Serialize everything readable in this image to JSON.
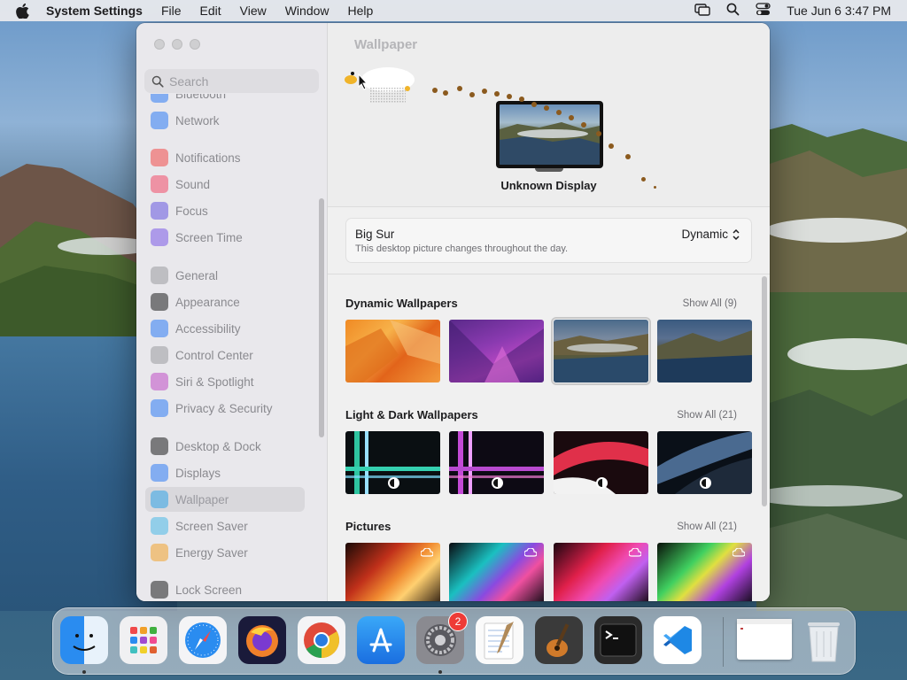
{
  "menubar": {
    "app_name": "System Settings",
    "menus": [
      "File",
      "Edit",
      "View",
      "Window",
      "Help"
    ],
    "clock": "Tue Jun 6  3:47 PM"
  },
  "sidebar": {
    "search_placeholder": "Search",
    "items": [
      {
        "label": "Bluetooth",
        "icon": "bluetooth-icon",
        "color": "#2f7cf6"
      },
      {
        "label": "Network",
        "icon": "globe-icon",
        "color": "#2f7cf6"
      },
      {
        "label": "Notifications",
        "icon": "bell-icon",
        "color": "#f24a4a"
      },
      {
        "label": "Sound",
        "icon": "speaker-icon",
        "color": "#f24a6a"
      },
      {
        "label": "Focus",
        "icon": "moon-icon",
        "color": "#6655e0"
      },
      {
        "label": "Screen Time",
        "icon": "hourglass-icon",
        "color": "#7b5ae8"
      },
      {
        "label": "General",
        "icon": "gear-icon",
        "color": "#9a9aa0"
      },
      {
        "label": "Appearance",
        "icon": "appearance-icon",
        "color": "#1d1d1f"
      },
      {
        "label": "Accessibility",
        "icon": "accessibility-icon",
        "color": "#2f7cf6"
      },
      {
        "label": "Control Center",
        "icon": "control-center-icon",
        "color": "#9a9aa0"
      },
      {
        "label": "Siri & Spotlight",
        "icon": "siri-icon",
        "color": "#c04cc6"
      },
      {
        "label": "Privacy & Security",
        "icon": "hand-icon",
        "color": "#2f7cf6"
      },
      {
        "label": "Desktop & Dock",
        "icon": "dock-icon",
        "color": "#1d1d1f"
      },
      {
        "label": "Displays",
        "icon": "sun-icon",
        "color": "#2f7cf6"
      },
      {
        "label": "Wallpaper",
        "icon": "wallpaper-icon",
        "color": "#2fa4e8"
      },
      {
        "label": "Screen Saver",
        "icon": "screensaver-icon",
        "color": "#4ab8e8"
      },
      {
        "label": "Energy Saver",
        "icon": "battery-icon",
        "color": "#f2a22e"
      },
      {
        "label": "Lock Screen",
        "icon": "lock-icon",
        "color": "#1d1d1f"
      }
    ],
    "selected": "Wallpaper"
  },
  "content": {
    "title": "Wallpaper",
    "display_name": "Unknown Display",
    "wallpaper": {
      "name": "Big Sur",
      "description": "This desktop picture changes throughout the day.",
      "mode": "Dynamic"
    },
    "sections": [
      {
        "title": "Dynamic Wallpapers",
        "show_all": "Show All (9)"
      },
      {
        "title": "Light & Dark Wallpapers",
        "show_all": "Show All (21)"
      },
      {
        "title": "Pictures",
        "show_all": "Show All (21)"
      }
    ]
  },
  "dock": {
    "apps": [
      {
        "name": "Finder",
        "icon": "finder-icon",
        "running": true
      },
      {
        "name": "Launchpad",
        "icon": "launchpad-icon",
        "running": false
      },
      {
        "name": "Safari",
        "icon": "safari-icon",
        "running": false
      },
      {
        "name": "Firefox",
        "icon": "firefox-icon",
        "running": false
      },
      {
        "name": "Chrome",
        "icon": "chrome-icon",
        "running": false
      },
      {
        "name": "App Store",
        "icon": "app-store-icon",
        "running": false
      },
      {
        "name": "System Settings",
        "icon": "system-settings-icon",
        "running": true,
        "badge": "2"
      },
      {
        "name": "TextEdit",
        "icon": "textedit-icon",
        "running": false
      },
      {
        "name": "GarageBand",
        "icon": "garageband-icon",
        "running": false
      },
      {
        "name": "Terminal",
        "icon": "terminal-icon",
        "running": false
      },
      {
        "name": "VS Code",
        "icon": "vscode-icon",
        "running": false
      }
    ]
  }
}
